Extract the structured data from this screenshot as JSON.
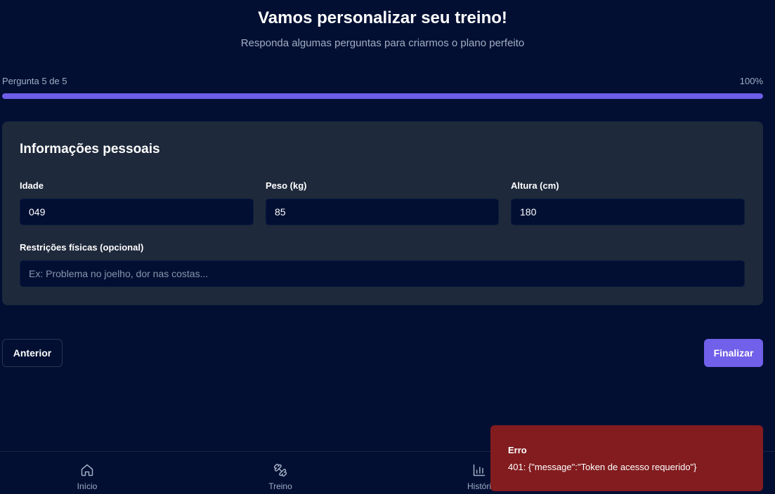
{
  "header": {
    "title": "Vamos personalizar seu treino!",
    "subtitle": "Responda algumas perguntas para criarmos o plano perfeito"
  },
  "progress": {
    "label": "Pergunta 5 de 5",
    "percent_label": "100%",
    "fraction": 1.0,
    "color": "#6d5ee8"
  },
  "form": {
    "section_title": "Informações pessoais",
    "age": {
      "label": "Idade",
      "value": "049"
    },
    "weight": {
      "label": "Peso (kg)",
      "value": "85"
    },
    "height": {
      "label": "Altura (cm)",
      "value": "180"
    },
    "restrictions": {
      "label": "Restrições físicas (opcional)",
      "value": "",
      "placeholder": "Ex: Problema no joelho, dor nas costas..."
    }
  },
  "actions": {
    "previous_label": "Anterior",
    "finish_label": "Finalizar",
    "finish_color": "#7160ea"
  },
  "bottom_nav": {
    "items": [
      {
        "label": "Início",
        "icon": "home-icon"
      },
      {
        "label": "Treino",
        "icon": "dumbbell-icon"
      },
      {
        "label": "Históri",
        "icon": "bar-chart-icon"
      }
    ]
  },
  "toast": {
    "title": "Erro",
    "message": "401: {\"message\":\"Token de acesso requerido\"}",
    "color": "#821c1f"
  }
}
